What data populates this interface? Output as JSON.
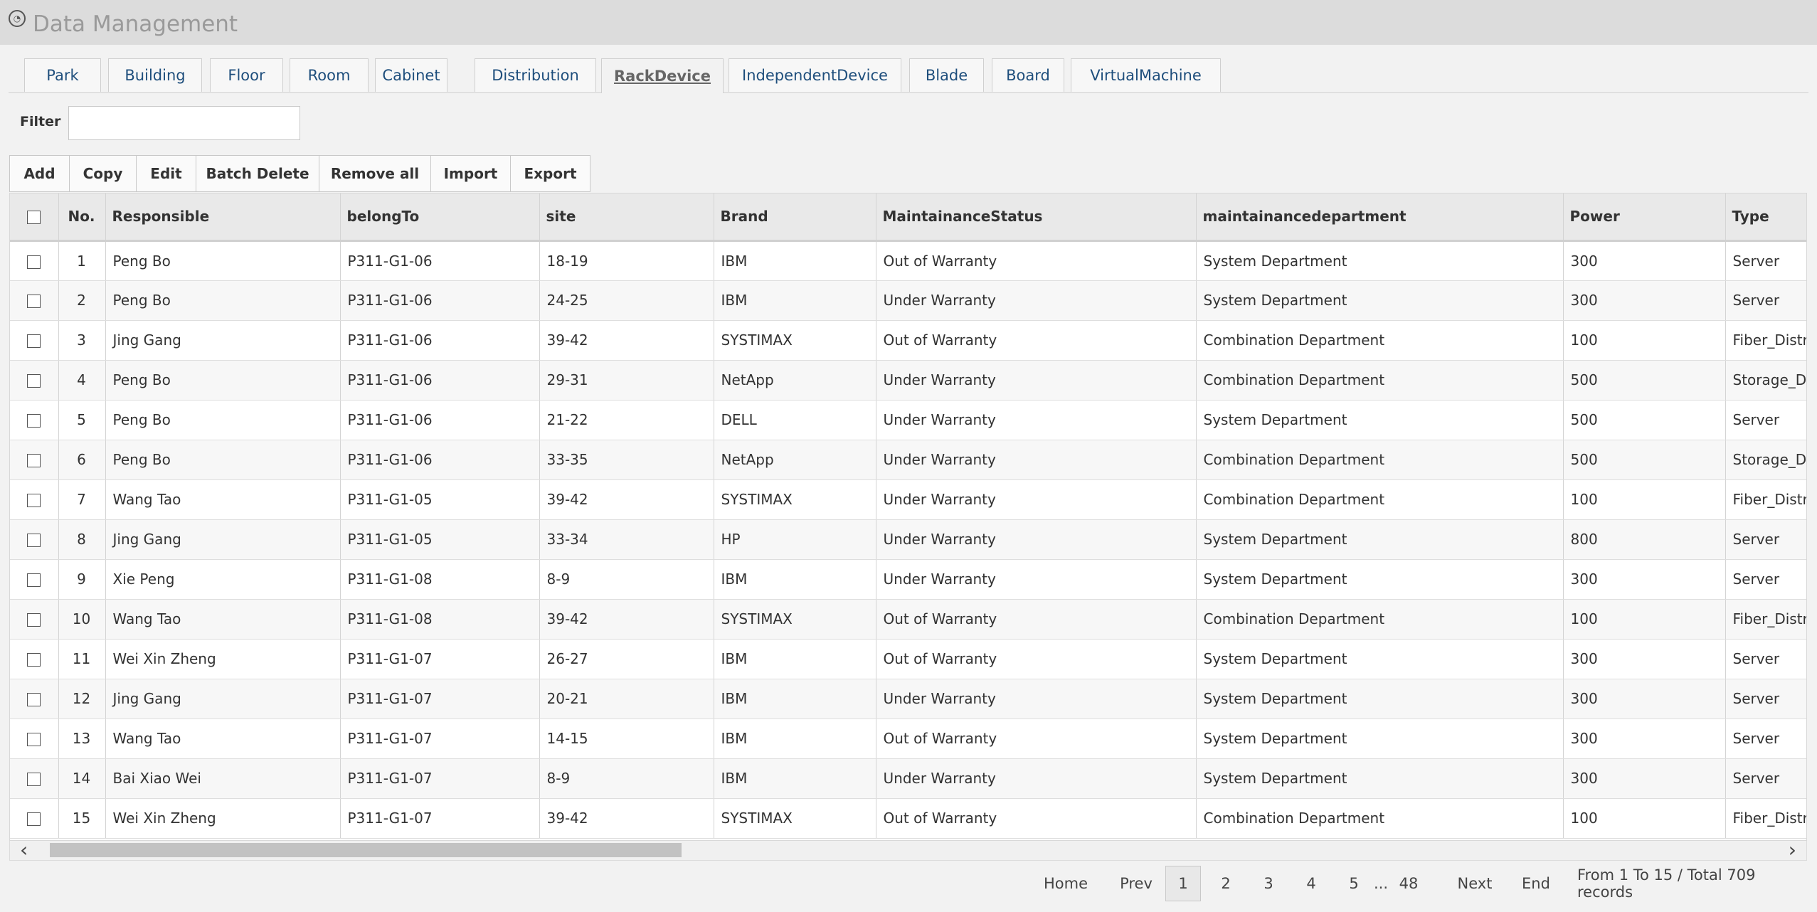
{
  "app": {
    "title": "Data Management"
  },
  "tabs": [
    "Park",
    "Building",
    "Floor",
    "Room",
    "Cabinet",
    "Distribution",
    "RackDevice",
    "IndependentDevice",
    "Blade",
    "Board",
    "VirtualMachine"
  ],
  "active_tab": "RackDevice",
  "filter": {
    "label": "Filter",
    "value": ""
  },
  "toolbar": [
    "Add",
    "Copy",
    "Edit",
    "Batch Delete",
    "Remove all",
    "Import",
    "Export"
  ],
  "columns": [
    "No.",
    "Responsible",
    "belongTo",
    "site",
    "Brand",
    "MaintainanceStatus",
    "maintainancedepartment",
    "Power",
    "Type"
  ],
  "rows": [
    [
      "1",
      "Peng Bo",
      "P311-G1-06",
      "18-19",
      "IBM",
      "Out of Warranty",
      "System Department",
      "300",
      "Server"
    ],
    [
      "2",
      "Peng Bo",
      "P311-G1-06",
      "24-25",
      "IBM",
      "Under Warranty",
      "System Department",
      "300",
      "Server"
    ],
    [
      "3",
      "Jing Gang",
      "P311-G1-06",
      "39-42",
      "SYSTIMAX",
      "Out of Warranty",
      "Combination Department",
      "100",
      "Fiber_Distr"
    ],
    [
      "4",
      "Peng Bo",
      "P311-G1-06",
      "29-31",
      "NetApp",
      "Under Warranty",
      "Combination Department",
      "500",
      "Storage_D"
    ],
    [
      "5",
      "Peng Bo",
      "P311-G1-06",
      "21-22",
      "DELL",
      "Under Warranty",
      "System Department",
      "500",
      "Server"
    ],
    [
      "6",
      "Peng Bo",
      "P311-G1-06",
      "33-35",
      "NetApp",
      "Under Warranty",
      "Combination Department",
      "500",
      "Storage_D"
    ],
    [
      "7",
      "Wang Tao",
      "P311-G1-05",
      "39-42",
      "SYSTIMAX",
      "Under Warranty",
      "Combination Department",
      "100",
      "Fiber_Distr"
    ],
    [
      "8",
      "Jing Gang",
      "P311-G1-05",
      "33-34",
      "HP",
      "Under Warranty",
      "System Department",
      "800",
      "Server"
    ],
    [
      "9",
      "Xie Peng",
      "P311-G1-08",
      "8-9",
      "IBM",
      "Under Warranty",
      "System Department",
      "300",
      "Server"
    ],
    [
      "10",
      "Wang Tao",
      "P311-G1-08",
      "39-42",
      "SYSTIMAX",
      "Out of Warranty",
      "Combination Department",
      "100",
      "Fiber_Distr"
    ],
    [
      "11",
      "Wei Xin Zheng",
      "P311-G1-07",
      "26-27",
      "IBM",
      "Out of Warranty",
      "System Department",
      "300",
      "Server"
    ],
    [
      "12",
      "Jing Gang",
      "P311-G1-07",
      "20-21",
      "IBM",
      "Under Warranty",
      "System Department",
      "300",
      "Server"
    ],
    [
      "13",
      "Wang Tao",
      "P311-G1-07",
      "14-15",
      "IBM",
      "Out of Warranty",
      "System Department",
      "300",
      "Server"
    ],
    [
      "14",
      "Bai Xiao Wei",
      "P311-G1-07",
      "8-9",
      "IBM",
      "Under Warranty",
      "System Department",
      "300",
      "Server"
    ],
    [
      "15",
      "Wei Xin Zheng",
      "P311-G1-07",
      "39-42",
      "SYSTIMAX",
      "Out of Warranty",
      "Combination Department",
      "100",
      "Fiber_Distr"
    ]
  ],
  "pager": {
    "home": "Home",
    "prev": "Prev",
    "pages": [
      "1",
      "2",
      "3",
      "4",
      "5"
    ],
    "current": "1",
    "ellipsis": "...",
    "last_page": "48",
    "next": "Next",
    "end": "End",
    "info": "From 1 To 15 / Total 709 records"
  },
  "colors": {
    "tab_text": "#1e4e7c",
    "title_text": "#9a9a9a",
    "titlebar_bg": "#dcdcdc"
  },
  "icons": {
    "app": "app-logo-icon",
    "scroll_left": "chevron-left-icon",
    "scroll_right": "chevron-right-icon"
  }
}
